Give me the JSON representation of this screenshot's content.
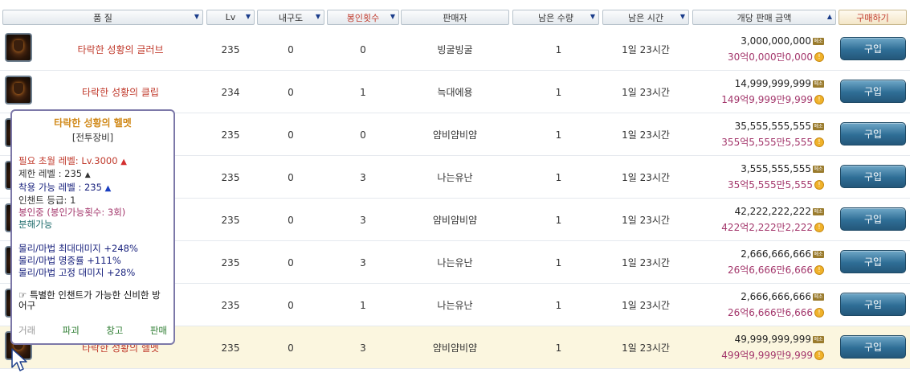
{
  "headers": {
    "quality": "품 질",
    "level": "Lv",
    "durability": "내구도",
    "seal_count": "봉인횟수",
    "seller": "판매자",
    "remaining_qty": "남은 수량",
    "remaining_time": "남은 시간",
    "unit_price": "개당 판매 금액",
    "buy": "구매하기"
  },
  "rows": [
    {
      "name": "타락한 성황의 글러브",
      "lv": "235",
      "dur": "0",
      "seal": "0",
      "seller": "빙굴빙굴",
      "qty": "1",
      "time": "1일 23시간",
      "price": "3,000,000,000",
      "price_kr": "30억0,000만0,000",
      "buy": "구입"
    },
    {
      "name": "타락한 성황의 클립",
      "lv": "234",
      "dur": "0",
      "seal": "1",
      "seller": "늑대에용",
      "qty": "1",
      "time": "1일 23시간",
      "price": "14,999,999,999",
      "price_kr": "149억9,999만9,999",
      "buy": "구입"
    },
    {
      "name": "",
      "lv": "235",
      "dur": "0",
      "seal": "0",
      "seller": "얌비얌비얌",
      "qty": "1",
      "time": "1일 23시간",
      "price": "35,555,555,555",
      "price_kr": "355억5,555만5,555",
      "buy": "구입"
    },
    {
      "name": "",
      "lv": "235",
      "dur": "0",
      "seal": "3",
      "seller": "나는유난",
      "qty": "1",
      "time": "1일 23시간",
      "price": "3,555,555,555",
      "price_kr": "35억5,555만5,555",
      "buy": "구입"
    },
    {
      "name": "",
      "lv": "235",
      "dur": "0",
      "seal": "3",
      "seller": "얌비얌비얌",
      "qty": "1",
      "time": "1일 23시간",
      "price": "42,222,222,222",
      "price_kr": "422억2,222만2,222",
      "buy": "구입"
    },
    {
      "name": "",
      "lv": "235",
      "dur": "0",
      "seal": "3",
      "seller": "나는유난",
      "qty": "1",
      "time": "1일 23시간",
      "price": "2,666,666,666",
      "price_kr": "26억6,666만6,666",
      "buy": "구입"
    },
    {
      "name": "",
      "lv": "235",
      "dur": "0",
      "seal": "1",
      "seller": "나는유난",
      "qty": "1",
      "time": "1일 23시간",
      "price": "2,666,666,666",
      "price_kr": "26억6,666만6,666",
      "buy": "구입"
    },
    {
      "name": "타락한 성황의 헬멧",
      "lv": "235",
      "dur": "0",
      "seal": "3",
      "seller": "얌비얌비얌",
      "qty": "1",
      "time": "1일 23시간",
      "price": "49,999,999,999",
      "price_kr": "499억9,999만9,999",
      "buy": "구입"
    }
  ],
  "tooltip": {
    "title": "타락한 성황의 헬멧",
    "category": "[전투장비]",
    "req_level": "필요 초월 레벨: Lv.3000",
    "limit_level": "제한 레벨 : 235",
    "wear_level": "착용 가능 레벨 : 235",
    "enchant": "인챈트 등급: 1",
    "sealed": "봉인중 (봉인가능횟수: 3회)",
    "dismantle": "분해가능",
    "stat1": "물리/마법 최대대미지 +248%",
    "stat2": "물리/마법 명중률 +111%",
    "stat3": "물리/마법 고정 대미지 +28%",
    "special": "특별한 인챈트가 가능한 신비한 방어구",
    "actions": [
      "거래",
      "파괴",
      "창고",
      "판매"
    ]
  },
  "icons": {
    "sort": "triangle-down-icon",
    "sort_active": "triangle-up-icon",
    "meso": "meso-badge-icon",
    "coin": "gold-coin-icon"
  },
  "colors": {
    "item_name": "#c0392b",
    "price_korean": "#a3366b",
    "buy_button": "#2f6e96",
    "tooltip_title": "#d18a1b"
  }
}
